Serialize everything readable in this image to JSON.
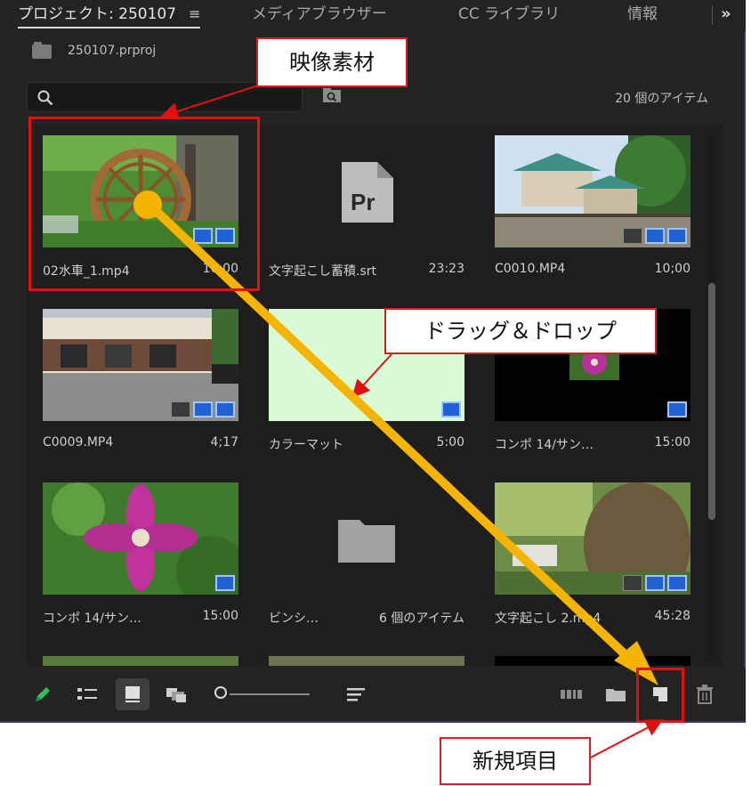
{
  "tabs": {
    "project": "プロジェクト: 250107",
    "project_menu": "≡",
    "media_browser": "メディアブラウザー",
    "cc_library": "CC ライブラリ",
    "info": "情報",
    "more": "»"
  },
  "project_file": {
    "name": "250107.prproj"
  },
  "search": {
    "placeholder": "",
    "value": ""
  },
  "item_count": "20 個のアイテム",
  "items": [
    {
      "name": "02水車_1.mp4",
      "duration": "10;00",
      "thumb": "waterwheel-video",
      "badges": [
        "video",
        "audio"
      ]
    },
    {
      "name": "文字起こし蓄積.srt",
      "duration": "23:23",
      "thumb": "premiere-file-icon",
      "badges": []
    },
    {
      "name": "C0010.MP4",
      "duration": "10;00",
      "thumb": "shrine-video",
      "badges": [
        "proxy",
        "video",
        "audio"
      ]
    },
    {
      "name": "C0009.MP4",
      "duration": "4;17",
      "thumb": "building-video",
      "badges": [
        "proxy",
        "video",
        "audio"
      ]
    },
    {
      "name": "カラーマット",
      "duration": "5:00",
      "thumb": "color-matte",
      "badges": [
        "video"
      ]
    },
    {
      "name": "コンポ 14/サン…",
      "duration": "15:00",
      "thumb": "flower-small-video",
      "badges": [
        "video"
      ]
    },
    {
      "name": "コンポ 14/サン…",
      "duration": "15:00",
      "thumb": "clematis-video",
      "badges": [
        "video"
      ]
    },
    {
      "name": "ビンシ…",
      "duration": "6 個のアイテム",
      "thumb": "bin-folder-icon",
      "badges": []
    },
    {
      "name": "文字起こし 2.mp4",
      "duration": "45:28",
      "thumb": "tree-path-video",
      "badges": [
        "proxy",
        "video",
        "audio"
      ]
    }
  ],
  "toolbar": {
    "icons": [
      "pencil-icon",
      "list-view-icon",
      "icon-view-icon",
      "freeform-view-icon",
      "zoom-slider",
      "sort-icon",
      "automate-to-sequence-icon",
      "new-bin-icon",
      "new-item-icon",
      "trash-icon"
    ],
    "zoom_level": 0.0
  },
  "annotations": {
    "video_material": "映像素材",
    "drag_and_drop": "ドラッグ＆ドロップ",
    "new_item": "新規項目"
  },
  "colors": {
    "panel_bg": "#232323",
    "grid_bg": "#1e1e1e",
    "badge_blue": "#1e62d6",
    "annotation_red": "#e01010",
    "arrow_yellow": "#ffb400",
    "matte_green": "#d8fbd5"
  }
}
